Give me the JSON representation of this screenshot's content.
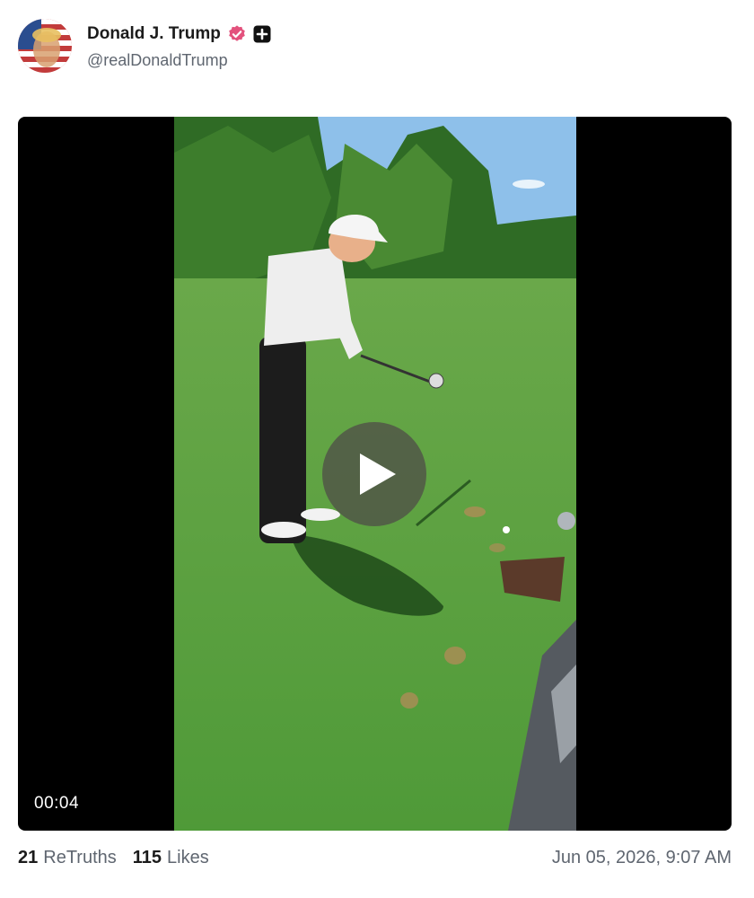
{
  "post": {
    "author": {
      "display_name": "Donald J. Trump",
      "handle": "@realDonaldTrump",
      "verified_icon": "verified-badge-icon",
      "plus_icon": "plus-badge-icon",
      "verified_color": "#e3527d"
    },
    "video": {
      "duration": "00:04",
      "play_icon": "play-icon"
    },
    "stats": {
      "retruths_count": "21",
      "retruths_label": "ReTruths",
      "likes_count": "115",
      "likes_label": "Likes"
    },
    "timestamp": "Jun 05, 2026, 9:07 AM"
  }
}
